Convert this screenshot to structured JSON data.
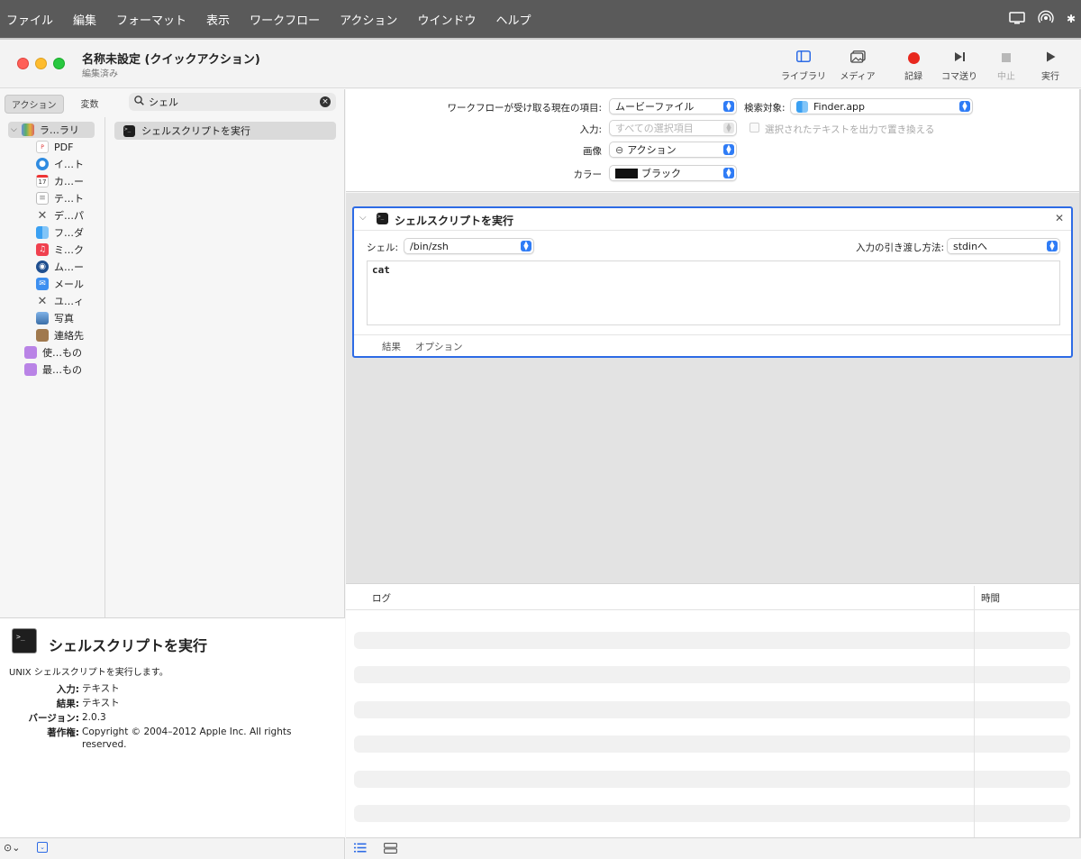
{
  "menubar": {
    "items": [
      "ファイル",
      "編集",
      "フォーマット",
      "表示",
      "ワークフロー",
      "アクション",
      "ウインドウ",
      "ヘルプ"
    ]
  },
  "window": {
    "title": "名称未設定 (クイックアクション)",
    "subtitle": "編集済み"
  },
  "toolbar": {
    "library_label": "ライブラリ",
    "media_label": "メディア",
    "record_label": "記録",
    "step_label": "コマ送り",
    "stop_label": "中止",
    "run_label": "実行",
    "record_color": "#e8281e"
  },
  "left": {
    "seg_actions": "アクション",
    "seg_variables": "変数",
    "search_value": "シェル",
    "library_root": "ラ…ラリ",
    "library_items": [
      "PDF",
      "イ…ト",
      "カ…ー",
      "テ…ト",
      "デ…パ",
      "フ…ダ",
      "ミ…ク",
      "ム…ー",
      "メール",
      "ユ…ィ",
      "写真",
      "連絡先"
    ],
    "library_folders": [
      "使…もの",
      "最…もの"
    ],
    "calendar_day": "17",
    "results": [
      "シェルスクリプトを実行"
    ]
  },
  "description": {
    "title": "シェルスクリプトを実行",
    "summary": "UNIX シェルスクリプトを実行します。",
    "input_key": "入力:",
    "input_val": "テキスト",
    "result_key": "結果:",
    "result_val": "テキスト",
    "version_key": "バージョン:",
    "version_val": "2.0.3",
    "copyright_key": "著作権:",
    "copyright_val": "Copyright © 2004–2012 Apple Inc.  All rights reserved."
  },
  "workflow": {
    "receives_label": "ワークフローが受け取る現在の項目:",
    "receives_value": "ムービーファイル",
    "in_label": "検索対象:",
    "in_value": "Finder.app",
    "input_label": "入力:",
    "input_value": "すべての選択項目",
    "replace_label": "選択されたテキストを出力で置き換える",
    "image_label": "画像",
    "image_value": "アクション",
    "color_label": "カラー",
    "color_value": "ブラック",
    "color_swatch": "#111111"
  },
  "action": {
    "title": "シェルスクリプトを実行",
    "shell_label": "シェル:",
    "shell_value": "/bin/zsh",
    "pass_label": "入力の引き渡し方法:",
    "pass_value": "stdinへ",
    "script": "cat",
    "tab_results": "結果",
    "tab_options": "オプション",
    "accent": "#2d6be5"
  },
  "log": {
    "col_log": "ログ",
    "col_time": "時間"
  }
}
